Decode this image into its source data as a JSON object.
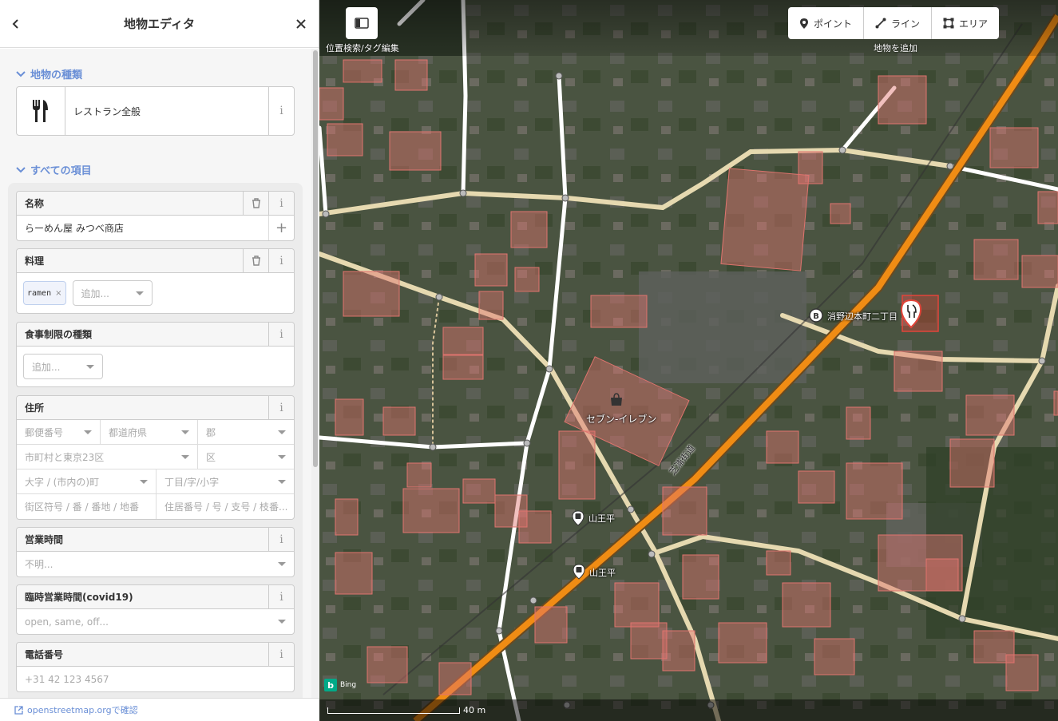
{
  "sidebar": {
    "title": "地物エディタ",
    "section_type": "地物の種類",
    "preset_name": "レストラン全般",
    "section_fields": "すべての項目",
    "footer_link": "openstreetmap.orgで確認"
  },
  "fields": {
    "name": {
      "label": "名称",
      "value": "らーめん屋 みつべ商店"
    },
    "cuisine": {
      "label": "料理",
      "chip": "ramen",
      "add_placeholder": "追加..."
    },
    "diet": {
      "label": "食事制限の種類",
      "add_placeholder": "追加..."
    },
    "address": {
      "label": "住所",
      "postcode": "郵便番号",
      "province": "都道府県",
      "county": "郡",
      "city": "市町村と東京23区",
      "district": "区",
      "quarter": "大字 / (市内の)町",
      "neighbourhood": "丁目/字/小字",
      "block": "街区符号 / 番 / 番地 / 地番",
      "housenumber": "住居番号 / 号 / 支号 / 枝番..."
    },
    "opening_hours": {
      "label": "営業時間",
      "placeholder": "不明..."
    },
    "opening_hours_covid": {
      "label": "臨時営業時間(covid19)",
      "placeholder": "open, same, off..."
    },
    "phone": {
      "label": "電話番号",
      "placeholder": "+31 42 123 4567"
    }
  },
  "map": {
    "panel_toggle_label": "位置検索/タグ編集",
    "add_label": "地物を追加",
    "modes": [
      "ポイント",
      "ライン",
      "エリア"
    ],
    "labels": {
      "seven_eleven": "セブン-イレブン",
      "street": "芝浦街道",
      "bus_stop_1": "消野辺本町二丁目",
      "bus_stop_2": "山王平",
      "bus_stop_3": "山王平"
    },
    "imagery": "Bing",
    "scale": "40 m",
    "colors": {
      "primary_road": "#f08c14",
      "residential": "#ffffff",
      "tertiary": "#e6d9b0",
      "building": "#e0746e",
      "selected": "#e2453a"
    }
  }
}
